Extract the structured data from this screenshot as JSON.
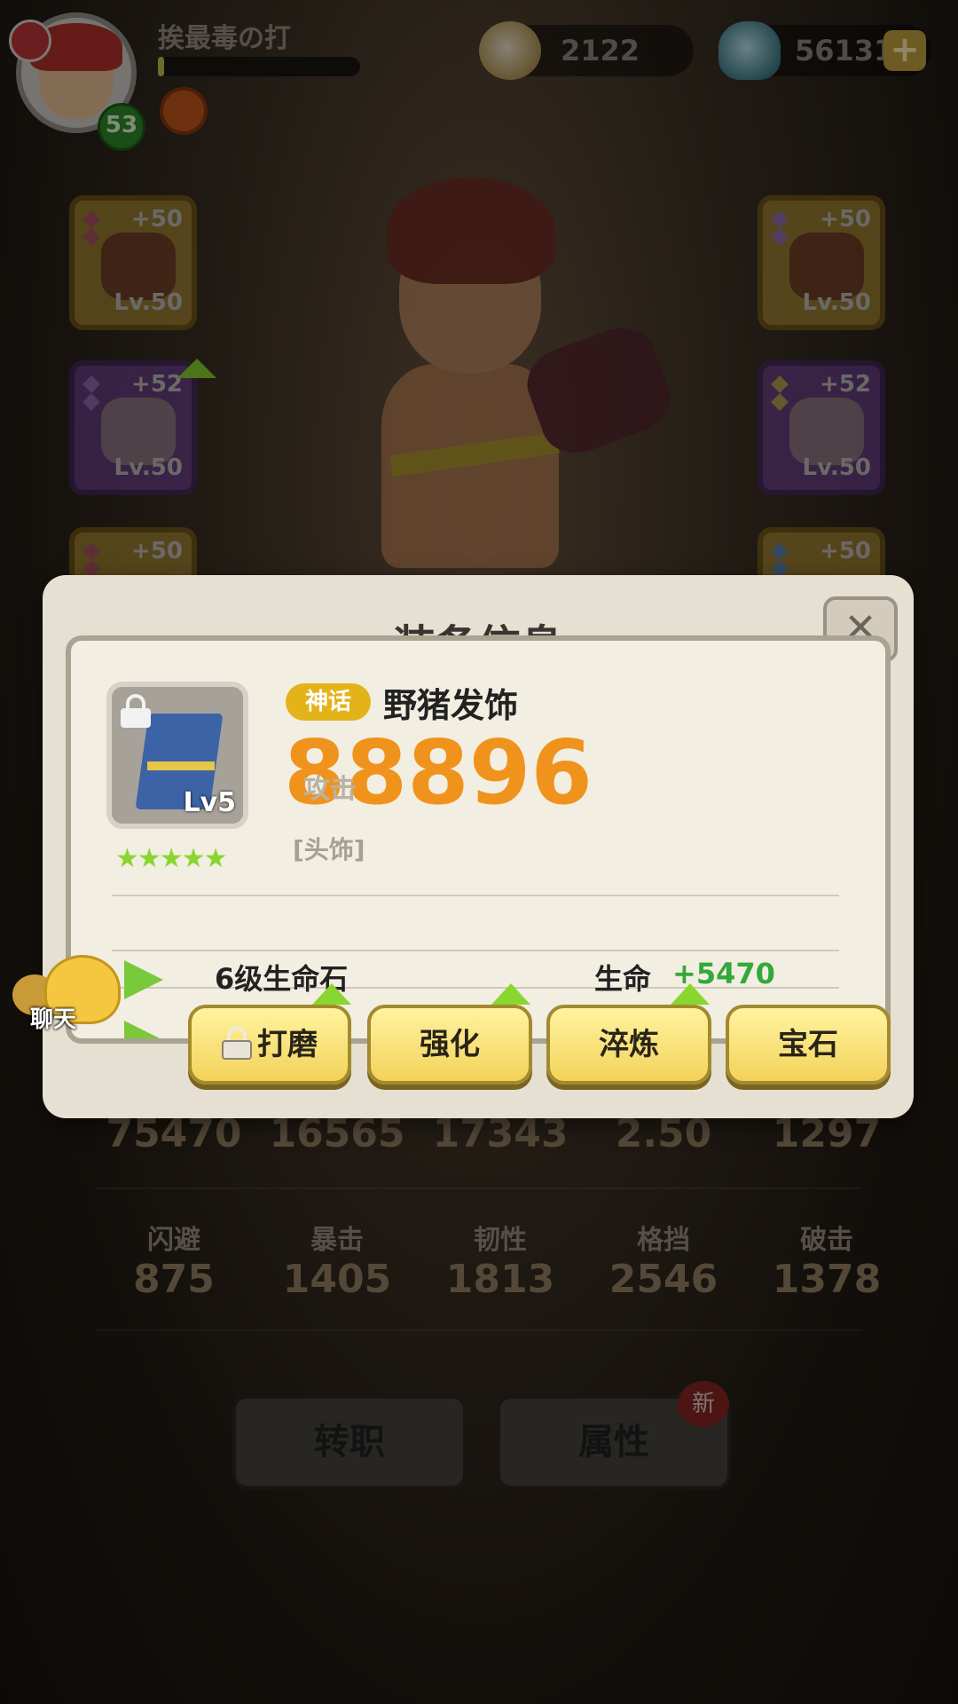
{
  "player": {
    "name": "挨最毒の打",
    "level": "53",
    "exp_fraction": 0.03
  },
  "currency": {
    "shells": "2122",
    "gems": "56131",
    "add_label": "+"
  },
  "equipment_slots": [
    {
      "side": "left",
      "rarity": "gold",
      "plus": "+50",
      "level": "Lv.50"
    },
    {
      "side": "left",
      "rarity": "purple",
      "plus": "+52",
      "level": "Lv.50",
      "upgradable": true
    },
    {
      "side": "left",
      "rarity": "gold",
      "plus": "+50",
      "level": ""
    },
    {
      "side": "right",
      "rarity": "gold",
      "plus": "+50",
      "level": "Lv.50"
    },
    {
      "side": "right",
      "rarity": "purple",
      "plus": "+52",
      "level": "Lv.50"
    },
    {
      "side": "right",
      "rarity": "gold",
      "plus": "+50",
      "level": ""
    }
  ],
  "dialog": {
    "title": "装备信息",
    "close": "✕",
    "item": {
      "rarity": "神话",
      "name": "野猪发饰",
      "power": "88896",
      "power_label": "攻击",
      "slot": "[头饰]",
      "level": "Lv5",
      "stars": "★★★★★",
      "star_count": 5
    },
    "properties": [
      {
        "name": "6级生命石",
        "stat": "生命",
        "bonus": "+5470"
      }
    ],
    "buttons": [
      {
        "label": "打磨",
        "locked": true,
        "upgradable": true
      },
      {
        "label": "强化",
        "locked": false,
        "upgradable": true
      },
      {
        "label": "淬炼",
        "locked": false,
        "upgradable": true
      },
      {
        "label": "宝石",
        "locked": false,
        "upgradable": false
      }
    ]
  },
  "chat": {
    "label": "聊天"
  },
  "stats_row1": {
    "values": [
      "75470",
      "16565",
      "17343",
      "2.50",
      "1297"
    ]
  },
  "stats_row2": {
    "labels": [
      "闪避",
      "暴击",
      "韧性",
      "格挡",
      "破击"
    ],
    "values": [
      "875",
      "1405",
      "1813",
      "2546",
      "1378"
    ]
  },
  "bottom_buttons": {
    "transfer": "转职",
    "attributes": "属性",
    "new_badge": "新"
  },
  "colors": {
    "power": "#f0931c",
    "rarity_badge": "#e3b31a",
    "bonus": "#34a83a",
    "action_button": "#f3d25a"
  }
}
